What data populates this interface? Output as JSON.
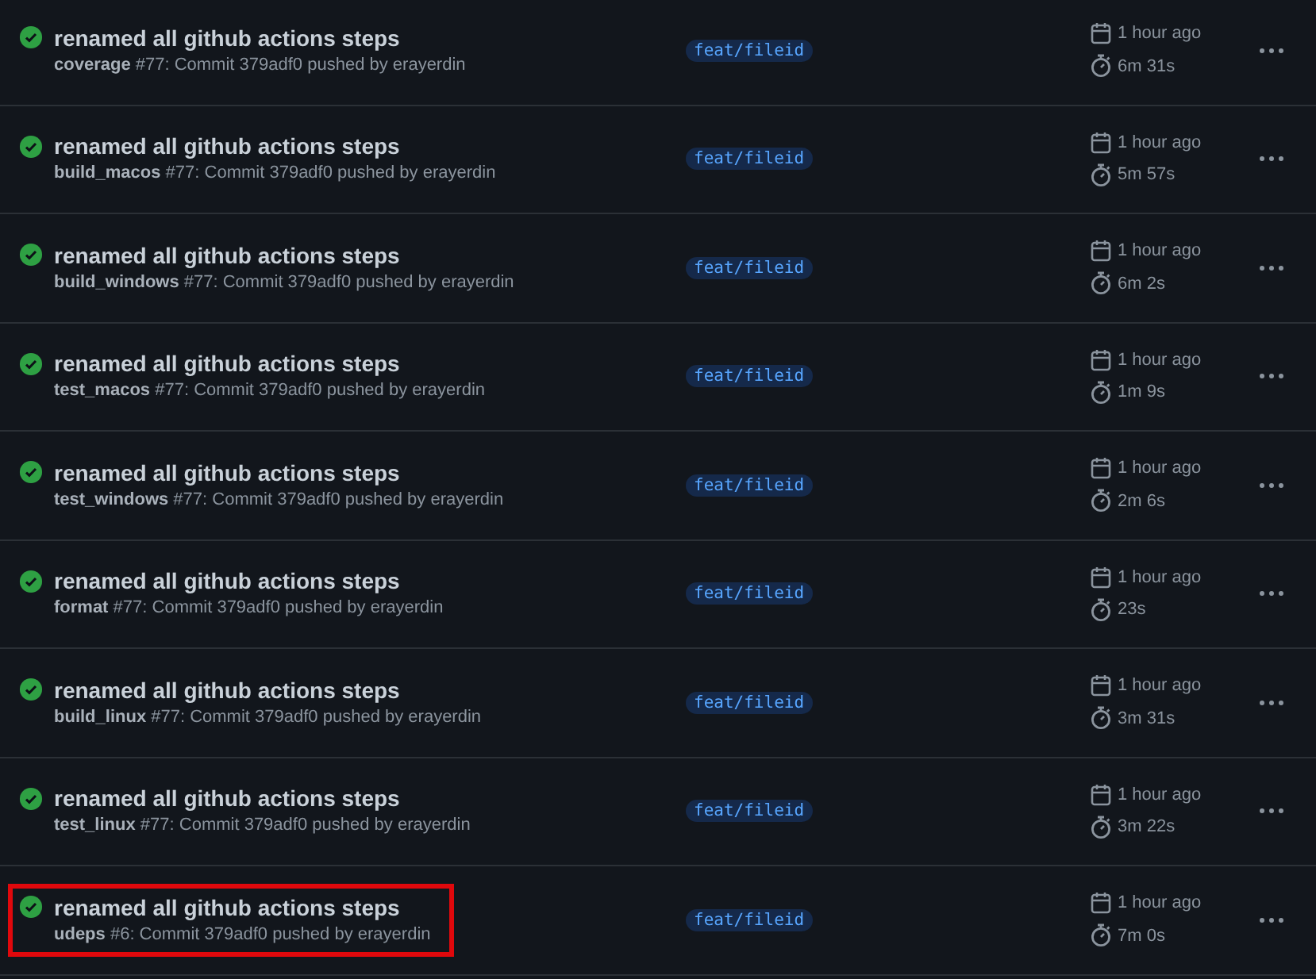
{
  "runs": [
    {
      "title": "renamed all github actions steps",
      "subtitle": "**coverage** #77: Commit 379adf0 pushed by erayerdin",
      "branch": "feat/fileid",
      "time": "1 hour ago",
      "duration": "6m 31s",
      "passed": true,
      "highlighted": false
    },
    {
      "title": "renamed all github actions steps",
      "subtitle": "**build_macos** #77: Commit 379adf0 pushed by erayerdin",
      "branch": "feat/fileid",
      "time": "1 hour ago",
      "duration": "5m 57s",
      "passed": true,
      "highlighted": false
    },
    {
      "title": "renamed all github actions steps",
      "subtitle": "**build_windows** #77: Commit 379adf0 pushed by erayerdin",
      "branch": "feat/fileid",
      "time": "1 hour ago",
      "duration": "6m 2s",
      "passed": true,
      "highlighted": false
    },
    {
      "title": "renamed all github actions steps",
      "subtitle": "**test_macos** #77: Commit 379adf0 pushed by erayerdin",
      "branch": "feat/fileid",
      "time": "1 hour ago",
      "duration": "1m 9s",
      "passed": true,
      "highlighted": false
    },
    {
      "title": "renamed all github actions steps",
      "subtitle": "**test_windows** #77: Commit 379adf0 pushed by erayerdin",
      "branch": "feat/fileid",
      "time": "1 hour ago",
      "duration": "2m 6s",
      "passed": true,
      "highlighted": false
    },
    {
      "title": "renamed all github actions steps",
      "subtitle": "**format** #77: Commit 379adf0 pushed by erayerdin",
      "branch": "feat/fileid",
      "time": "1 hour ago",
      "duration": "23s",
      "passed": true,
      "highlighted": false
    },
    {
      "title": "renamed all github actions steps",
      "subtitle": "**build_linux** #77: Commit 379adf0 pushed by erayerdin",
      "branch": "feat/fileid",
      "time": "1 hour ago",
      "duration": "3m 31s",
      "passed": true,
      "highlighted": false
    },
    {
      "title": "renamed all github actions steps",
      "subtitle": "**test_linux** #77: Commit 379adf0 pushed by erayerdin",
      "branch": "feat/fileid",
      "time": "1 hour ago",
      "duration": "3m 22s",
      "passed": true,
      "highlighted": false
    },
    {
      "title": "renamed all github actions steps",
      "subtitle": "**udeps** #6: Commit 379adf0 pushed by erayerdin",
      "branch": "feat/fileid",
      "time": "1 hour ago",
      "duration": "7m 0s",
      "passed": true,
      "highlighted": true
    }
  ]
}
